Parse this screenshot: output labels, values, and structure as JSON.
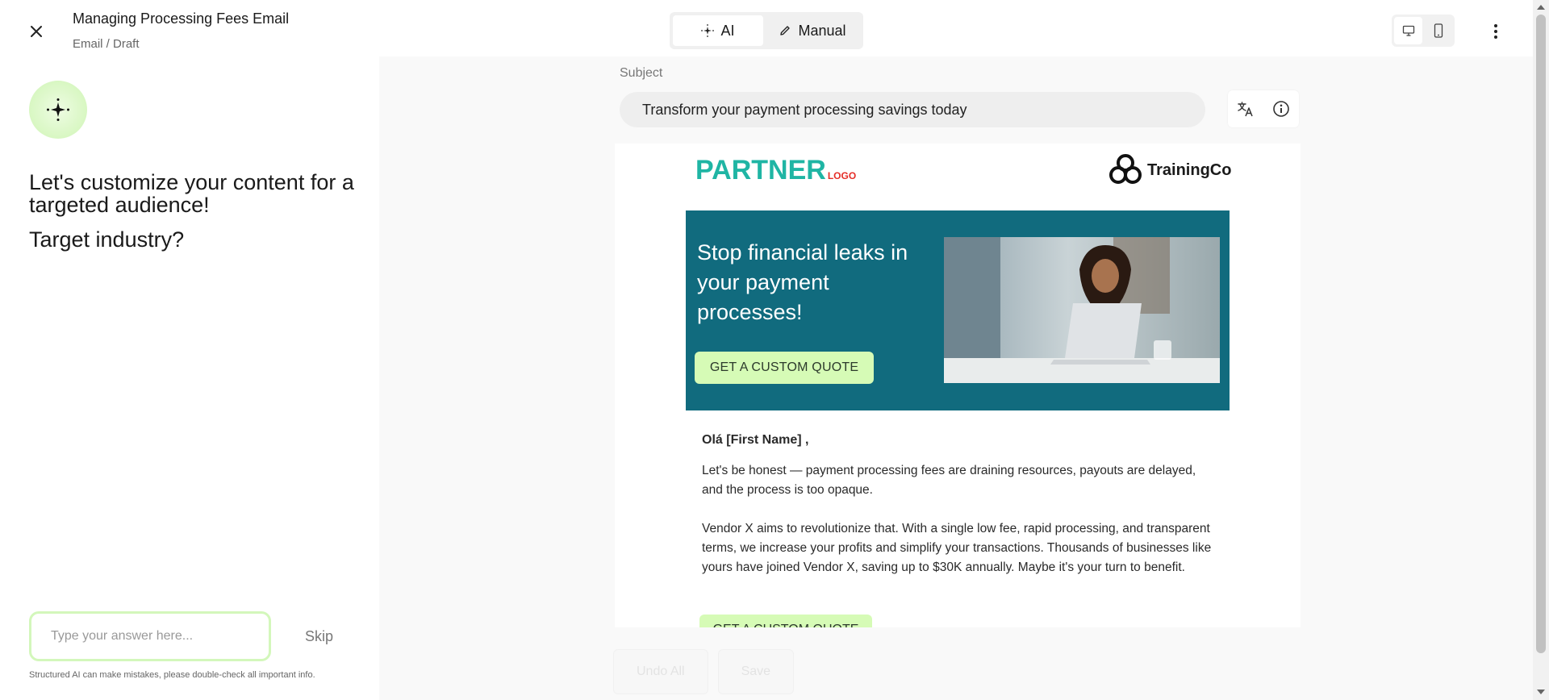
{
  "header": {
    "title": "Managing Processing Fees Email",
    "breadcrumb": "Email / Draft",
    "modes": [
      {
        "label": "AI",
        "icon": "sparkle-icon",
        "active": true
      },
      {
        "label": "Manual",
        "icon": "pencil-icon",
        "active": false
      }
    ],
    "device_views": [
      {
        "icon": "desktop-icon",
        "active": true
      },
      {
        "icon": "mobile-icon",
        "active": false
      }
    ]
  },
  "assistant": {
    "prompt": "Let's customize your content for a targeted audience!",
    "question": "Target industry?",
    "answer": {
      "value": "",
      "placeholder": "Type your answer here..."
    },
    "skip_label": "Skip",
    "disclaimer": "Structured AI can make mistakes, please double-check all important info."
  },
  "editor": {
    "subject_label": "Subject",
    "subject": "Transform your payment processing savings today",
    "tools": [
      "translate-icon",
      "info-icon"
    ],
    "email": {
      "partner_logo": "PARTNER",
      "partner_logo_suffix": "LOGO",
      "brand_logo": "TrainingCo",
      "hero_title": "Stop financial leaks in your payment processes!",
      "hero_cta": "GET A CUSTOM QUOTE",
      "greeting": "Olá  [First Name] ,",
      "paragraphs": [
        "Let's be honest — payment processing fees are draining resources, payouts are delayed, and the process is too opaque.",
        "Vendor X aims to revolutionize that. With a single low fee, rapid processing, and transparent terms, we increase your profits and simplify your transactions. Thousands of businesses like yours have joined Vendor X, saving up to $30K annually. Maybe it's your turn to benefit."
      ],
      "body_cta": "GET A CUSTOM QUOTE"
    },
    "actions": {
      "undo_all": "Undo All",
      "save": "Save"
    }
  },
  "colors": {
    "accent_green": "#d6fbb6",
    "hero_teal": "#116b7e",
    "partner_teal": "#1fb5a4",
    "partner_red": "#e52d27"
  }
}
